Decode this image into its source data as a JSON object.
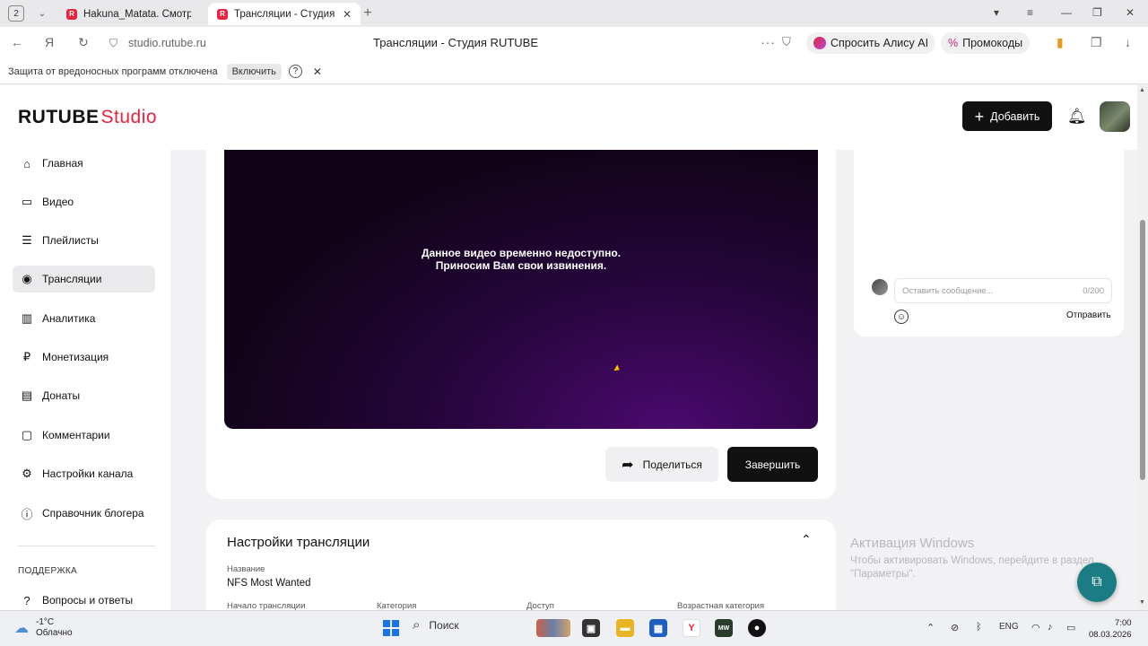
{
  "browser": {
    "tab_count": "2",
    "tabs": [
      {
        "title": "Hakuna_Matata. Смотрит",
        "active": false
      },
      {
        "title": "Трансляции - Студия R",
        "active": true
      }
    ],
    "url": "studio.rutube.ru",
    "page_title": "Трансляции - Студия RUTUBE",
    "alice_label": "Спросить Алису AI",
    "promo_label": "Промокоды",
    "infobar_message": "Защита от вредоносных программ отключена",
    "infobar_enable": "Включить",
    "infobar_help": "?"
  },
  "header": {
    "logo_main": "RUTUBE",
    "logo_studio": "Studio",
    "add_button": "Добавить"
  },
  "sidebar": {
    "items": [
      {
        "label": "Главная",
        "icon": "home-icon",
        "glyph": "⌂"
      },
      {
        "label": "Видео",
        "icon": "video-icon",
        "glyph": "▭"
      },
      {
        "label": "Плейлисты",
        "icon": "playlist-icon",
        "glyph": "☰"
      },
      {
        "label": "Трансляции",
        "icon": "broadcast-icon",
        "glyph": "◉"
      },
      {
        "label": "Аналитика",
        "icon": "analytics-icon",
        "glyph": "▥"
      },
      {
        "label": "Монетизация",
        "icon": "monetization-icon",
        "glyph": "₽"
      },
      {
        "label": "Донаты",
        "icon": "donate-icon",
        "glyph": "▤"
      },
      {
        "label": "Комментарии",
        "icon": "comments-icon",
        "glyph": "▢"
      },
      {
        "label": "Настройки канала",
        "icon": "settings-icon",
        "glyph": "⚙"
      },
      {
        "label": "Справочник блогера",
        "icon": "guide-icon",
        "glyph": "ⓘ"
      },
      {
        "label": "Вопросы и ответы",
        "icon": "faq-icon",
        "glyph": "?"
      }
    ],
    "active_index": 3,
    "support_heading": "ПОДДЕРЖКА"
  },
  "player": {
    "message_line1": "Данное видео временно недоступно.",
    "message_line2": "Приносим Вам свои извинения.",
    "share_button": "Поделиться",
    "end_button": "Завершить"
  },
  "chat": {
    "placeholder": "Оставить сообщение...",
    "counter": "0/200",
    "send_label": "Отправить"
  },
  "settings": {
    "title": "Настройки трансляции",
    "name_label": "Название",
    "name_value": "NFS Most Wanted",
    "start_label": "Начало трансляции",
    "category_label": "Категория",
    "access_label": "Доступ",
    "age_label": "Возрастная категория"
  },
  "watermark": {
    "title": "Активация Windows",
    "line1": "Чтобы активировать Windows, перейдите в раздел",
    "line2": "\"Параметры\"."
  },
  "taskbar": {
    "temperature": "-1°C",
    "weather": "Облачно",
    "search": "Поиск",
    "language": "ENG",
    "time": "7:00",
    "date": "08.03.2026"
  },
  "colors": {
    "brand_red": "#e5243f",
    "dark_button": "#111111",
    "fab_teal": "#1b7c83"
  }
}
